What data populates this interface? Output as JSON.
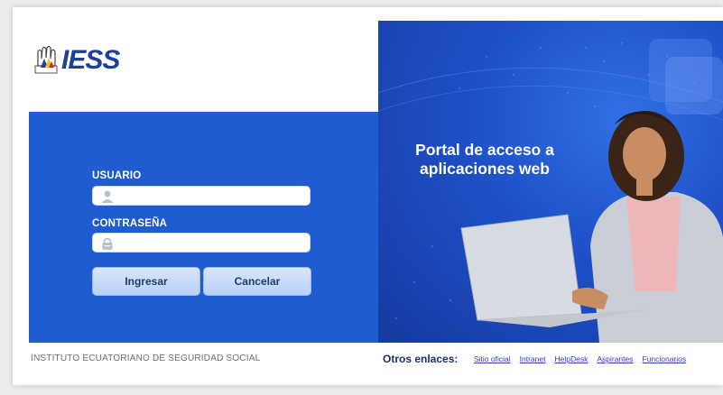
{
  "brand": {
    "logo_text": "IESS",
    "colors": {
      "primary_blue": "#1f5bd1",
      "dark_blue": "#153a9f",
      "button_light": "#c9dcf8"
    }
  },
  "login": {
    "username_label": "USUARIO",
    "username_value": "",
    "username_icon": "user-icon",
    "password_label": "CONTRASEÑA",
    "password_value": "",
    "password_icon": "lock-icon",
    "submit_label": "Ingresar",
    "cancel_label": "Cancelar"
  },
  "hero": {
    "title_line1": "Portal de acceso a",
    "title_line2": "aplicaciones web"
  },
  "footer": {
    "institute_name": "INSTITUTO ECUATORIANO DE SEGURIDAD SOCIAL",
    "other_links_label": "Otros enlaces:",
    "links": [
      "Sitio oficial",
      "Intranet",
      "HelpDesk",
      "Aspirantes",
      "Funcionarios"
    ]
  }
}
